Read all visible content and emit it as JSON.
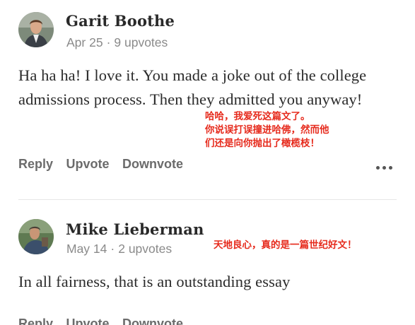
{
  "comments": [
    {
      "author": "Garit Boothe",
      "date": "Apr 25",
      "separator": "·",
      "upvotes": "9 upvotes",
      "text": "Ha ha ha! I love it. You made a joke out of the college admissions process. Then they admitted you anyway!",
      "annotation": [
        "哈哈，我爱死这篇文了。",
        "你说误打误撞进哈佛，然而他",
        "们还是向你抛出了橄榄枝！"
      ],
      "actions": {
        "reply": "Reply",
        "upvote": "Upvote",
        "downvote": "Downvote"
      }
    },
    {
      "author": "Mike Lieberman",
      "date": "May 14",
      "separator": "·",
      "upvotes": "2 upvotes",
      "text": "In all fairness, that is an outstanding essay",
      "annotation": [
        "天地良心，真的是一篇世纪好文！"
      ],
      "actions": {
        "reply": "Reply",
        "upvote": "Upvote",
        "downvote": "Downvote"
      }
    }
  ],
  "colors": {
    "annotation": "#e62a1c",
    "meta_text": "#8a8a8a",
    "action_text": "#6b6b6b"
  },
  "icons": {
    "more": "more-horizontal-icon"
  }
}
